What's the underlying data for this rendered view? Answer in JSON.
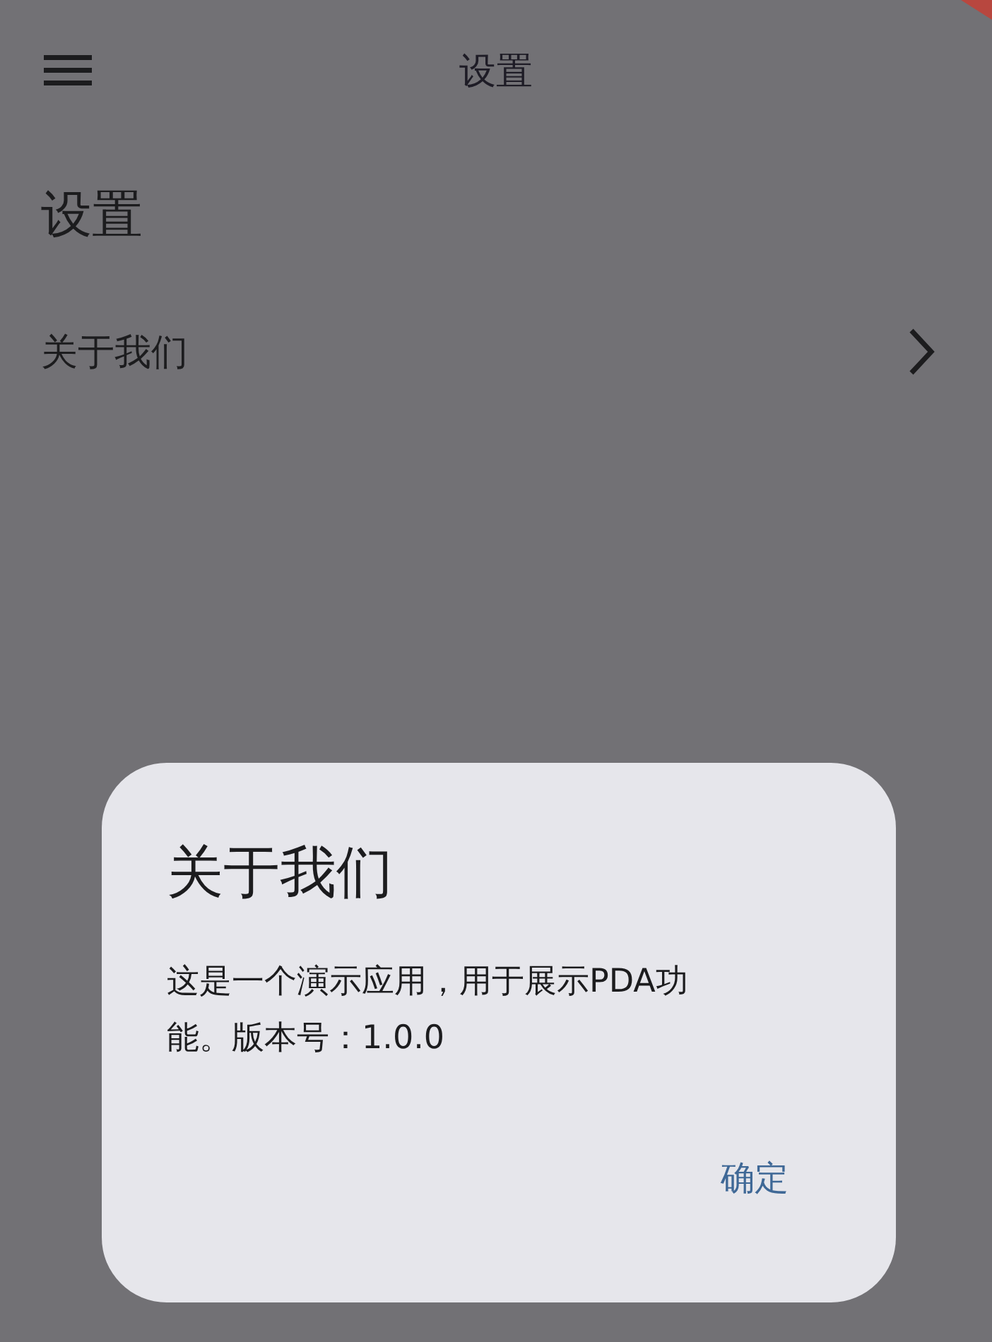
{
  "app_bar": {
    "title": "设置"
  },
  "page": {
    "heading": "设置",
    "items": [
      {
        "label": "关于我们"
      }
    ]
  },
  "dialog": {
    "title": "关于我们",
    "message": "这是一个演示应用，用于展示PDA功能。版本号：1.0.0",
    "buttons": [
      "确定"
    ]
  }
}
